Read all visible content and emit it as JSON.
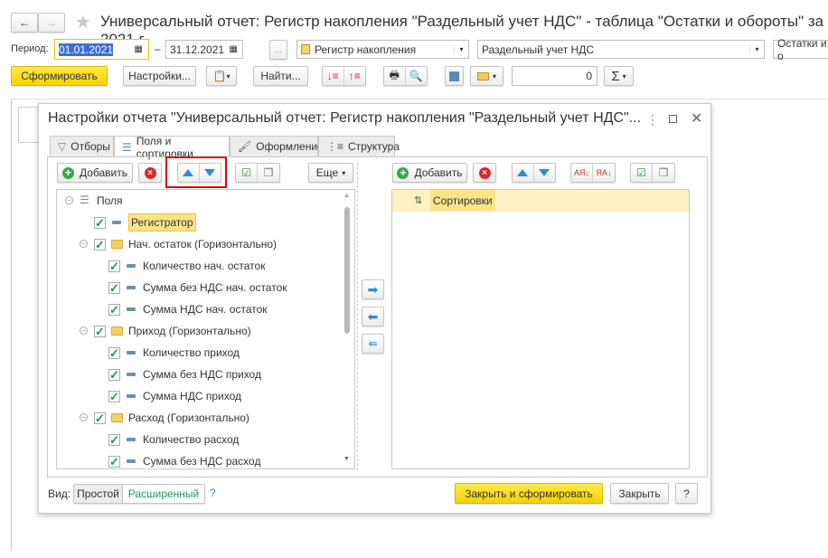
{
  "window": {
    "title": "Универсальный отчет: Регистр накопления \"Раздельный учет НДС\" - таблица \"Остатки и обороты\" за 2021 г."
  },
  "period": {
    "label": "Период:",
    "from": "01.01.2021",
    "to": "31.12.2021",
    "dash": "–",
    "more": "..."
  },
  "selects": {
    "type": "Регистр накопления",
    "register": "Раздельный учет НДС",
    "table": "Остатки и о"
  },
  "toolbar": {
    "generate": "Сформировать",
    "settings": "Настройки...",
    "find": "Найти...",
    "number": "0",
    "sigma": "Σ"
  },
  "dialog": {
    "title": "Настройки отчета \"Универсальный отчет: Регистр накопления \"Раздельный учет НДС\"...",
    "tabs": [
      {
        "label": "Отборы"
      },
      {
        "label": "Поля и сортировки"
      },
      {
        "label": "Оформление"
      },
      {
        "label": "Структура"
      }
    ],
    "left": {
      "add": "Добавить",
      "more": "Еще",
      "tree": [
        {
          "label": "Поля",
          "level": 0,
          "type": "root",
          "collapsible": true
        },
        {
          "label": "Регистратор",
          "level": 1,
          "type": "field",
          "checked": true,
          "selected": true
        },
        {
          "label": "Нач. остаток (Горизонтально)",
          "level": 1,
          "type": "folder",
          "checked": true,
          "collapsible": true
        },
        {
          "label": "Количество нач. остаток",
          "level": 2,
          "type": "field",
          "checked": true
        },
        {
          "label": "Сумма без НДС нач. остаток",
          "level": 2,
          "type": "field",
          "checked": true
        },
        {
          "label": "Сумма НДС нач. остаток",
          "level": 2,
          "type": "field",
          "checked": true
        },
        {
          "label": "Приход (Горизонтально)",
          "level": 1,
          "type": "folder",
          "checked": true,
          "collapsible": true
        },
        {
          "label": "Количество приход",
          "level": 2,
          "type": "field",
          "checked": true
        },
        {
          "label": "Сумма без НДС приход",
          "level": 2,
          "type": "field",
          "checked": true
        },
        {
          "label": "Сумма НДС приход",
          "level": 2,
          "type": "field",
          "checked": true
        },
        {
          "label": "Расход (Горизонтально)",
          "level": 1,
          "type": "folder",
          "checked": true,
          "collapsible": true
        },
        {
          "label": "Количество расход",
          "level": 2,
          "type": "field",
          "checked": true
        },
        {
          "label": "Сумма без НДС расход",
          "level": 2,
          "type": "field",
          "checked": true
        }
      ]
    },
    "right": {
      "add": "Добавить",
      "sort_header": "Сортировки"
    },
    "footer": {
      "view_label": "Вид:",
      "simple": "Простой",
      "extended": "Расширенный",
      "help": "?",
      "close_generate": "Закрыть и сформировать",
      "close": "Закрыть",
      "help_btn": "?"
    }
  },
  "colors": {
    "accent_yellow": "#f5d200",
    "highlight": "#fbe38a",
    "red_frame": "#e00000",
    "green_check": "#1f9a3a",
    "blue_arrow": "#2f8ad8"
  }
}
